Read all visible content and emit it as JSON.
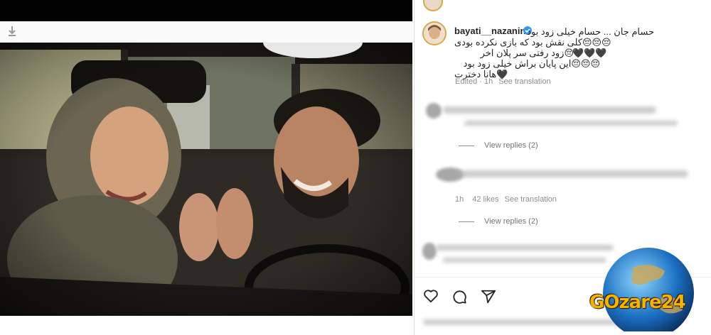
{
  "post": {
    "image_alt": "Photo of a smiling woman in a headscarf and a laughing bearded man inside a car"
  },
  "caption": {
    "username": "bayati__nazanin",
    "lines": [
      "حسام جان ... حسام خیلی زود بود",
      "😔😔😔کلی نقش بود که بازی نکرده بودی",
      "🖤🖤🖤",
      "😔زود رفتی سر پلان اخر",
      "😔😔😔این پایان براش خیلی زود بود",
      "🖤هانا دخترت"
    ],
    "time": "Edited · 1h",
    "see_translation": "See translation"
  },
  "comments": [
    {
      "view_replies": "View replies (2)"
    },
    {
      "time": "1h",
      "likes": "42 likes",
      "see_translation": "See translation",
      "view_replies": "View replies (2)"
    }
  ],
  "actions": {
    "like": "heart-icon",
    "comment": "comment-icon",
    "share": "share-icon"
  },
  "watermark": {
    "text": "GOzare24"
  },
  "colors": {
    "verified": "#3897f0",
    "story_ring": "#d6a94a",
    "watermark_text": "#f5b300"
  }
}
